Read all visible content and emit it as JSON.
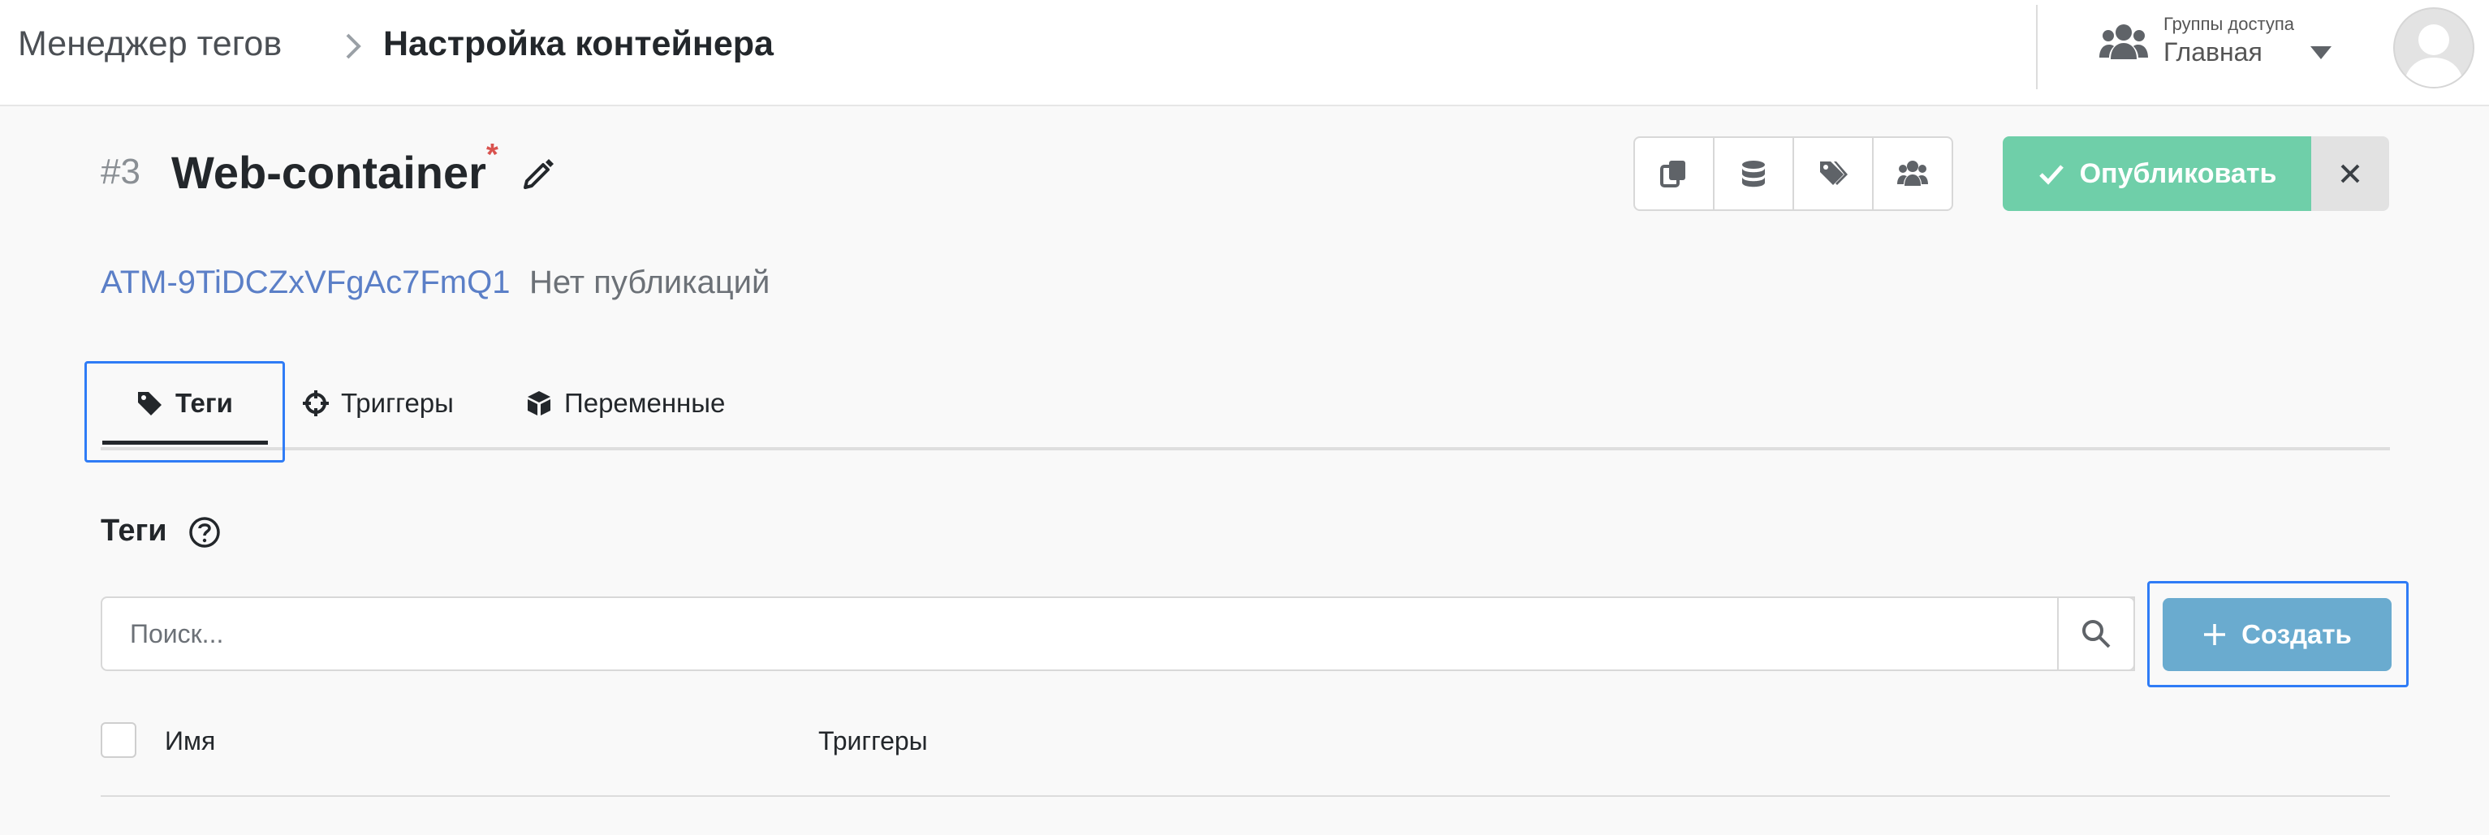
{
  "breadcrumb": {
    "parent": "Менеджер тегов",
    "current": "Настройка контейнера"
  },
  "access_groups": {
    "label": "Группы доступа",
    "selected": "Главная"
  },
  "container": {
    "number": "#3",
    "name": "Web-container",
    "unsaved_mark": "*",
    "id": "ATM-9TiDCZxVFgAc7FmQ1",
    "publication_status": "Нет публикаций"
  },
  "toolbar": {
    "icons": [
      "copy-icon",
      "database-icon",
      "tags-icon",
      "users-icon"
    ],
    "publish_label": "Опубликовать"
  },
  "tabs": [
    {
      "label": "Теги",
      "icon": "tag-icon",
      "active": true
    },
    {
      "label": "Триггеры",
      "icon": "crosshair-icon",
      "active": false
    },
    {
      "label": "Переменные",
      "icon": "cube-icon",
      "active": false
    }
  ],
  "section": {
    "title": "Теги"
  },
  "search": {
    "placeholder": "Поиск..."
  },
  "create_label": "Создать",
  "table": {
    "columns": [
      "Имя",
      "Триггеры"
    ]
  },
  "colors": {
    "publish": "#6fcfa9",
    "create": "#6aabcf",
    "link": "#5b7fc7",
    "required": "#d9534f",
    "focus": "#2f7cf6"
  }
}
